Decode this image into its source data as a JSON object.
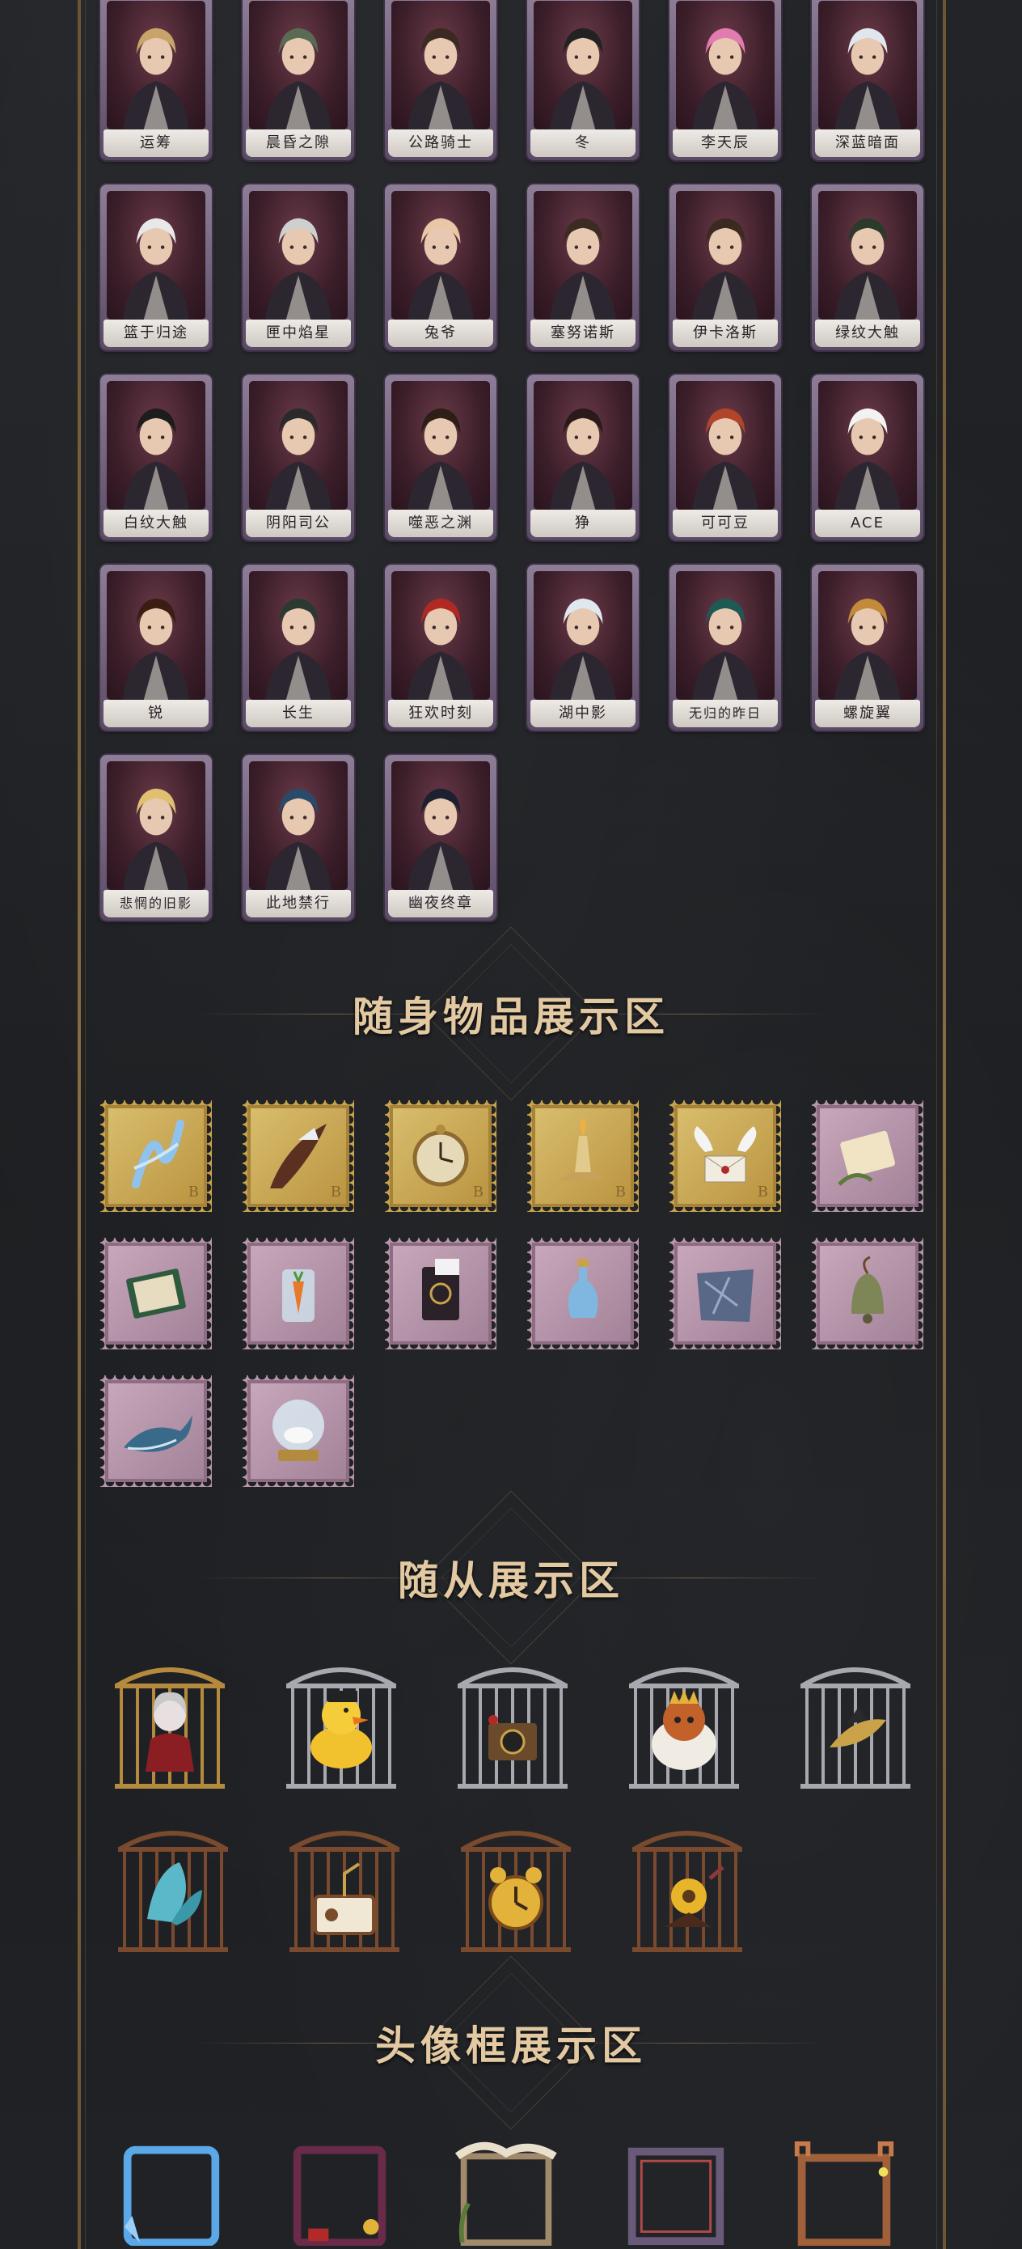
{
  "characters": [
    {
      "name": "运筹"
    },
    {
      "name": "晨昏之隙"
    },
    {
      "name": "公路骑士"
    },
    {
      "name": "冬"
    },
    {
      "name": "李天辰"
    },
    {
      "name": "深蓝暗面"
    },
    {
      "name": "篮于归途"
    },
    {
      "name": "匣中焰星"
    },
    {
      "name": "兔爷"
    },
    {
      "name": "塞努诺斯"
    },
    {
      "name": "伊卡洛斯"
    },
    {
      "name": "绿纹大触"
    },
    {
      "name": "白纹大触"
    },
    {
      "name": "阴阳司公"
    },
    {
      "name": "噬恶之渊"
    },
    {
      "name": "狰"
    },
    {
      "name": "可可豆"
    },
    {
      "name": "ACE"
    },
    {
      "name": "锐"
    },
    {
      "name": "长生"
    },
    {
      "name": "狂欢时刻"
    },
    {
      "name": "湖中影"
    },
    {
      "name": "无归的昨日"
    },
    {
      "name": "螺旋翼"
    },
    {
      "name": "悲惘的旧影"
    },
    {
      "name": "此地禁行"
    },
    {
      "name": "幽夜终章"
    }
  ],
  "sections": {
    "accessories_title": "随身物品展示区",
    "pets_title": "随从展示区",
    "avatar_frames_title": "头像框展示区"
  },
  "accessories": [
    {
      "style": "gold",
      "icon": "twisted-glass-icon",
      "tag": "B"
    },
    {
      "style": "gold",
      "icon": "feather-quill-icon",
      "tag": "B"
    },
    {
      "style": "gold",
      "icon": "pocket-watch-icon",
      "tag": "B"
    },
    {
      "style": "gold",
      "icon": "oil-lamp-icon",
      "tag": "B"
    },
    {
      "style": "gold",
      "icon": "winged-letter-icon",
      "tag": "B"
    },
    {
      "style": "pink",
      "icon": "scroll-icon",
      "tag": ""
    },
    {
      "style": "pink",
      "icon": "book-icon",
      "tag": ""
    },
    {
      "style": "pink",
      "icon": "carrot-jar-icon",
      "tag": ""
    },
    {
      "style": "pink",
      "icon": "card-box-icon",
      "tag": ""
    },
    {
      "style": "pink",
      "icon": "blue-bottle-icon",
      "tag": ""
    },
    {
      "style": "pink",
      "icon": "crystal-cloth-icon",
      "tag": ""
    },
    {
      "style": "pink",
      "icon": "bell-icon",
      "tag": ""
    },
    {
      "style": "pink",
      "icon": "whale-icon",
      "tag": ""
    },
    {
      "style": "pink",
      "icon": "snow-globe-icon",
      "tag": ""
    }
  ],
  "pets": [
    {
      "icon": "doll-pet-icon"
    },
    {
      "icon": "yellow-duck-pet-icon"
    },
    {
      "icon": "camera-pet-icon"
    },
    {
      "icon": "cat-king-pet-icon"
    },
    {
      "icon": "golden-quill-pet-icon"
    },
    {
      "icon": "leaf-pet-icon"
    },
    {
      "icon": "radio-pet-icon"
    },
    {
      "icon": "alarm-clock-pet-icon"
    },
    {
      "icon": "flower-gramophone-pet-icon"
    }
  ],
  "avatar_frames": [
    {
      "icon": "crystal-frame-icon"
    },
    {
      "icon": "carnival-frame-icon"
    },
    {
      "icon": "vine-frame-icon"
    },
    {
      "icon": "ornate-frame-icon"
    },
    {
      "icon": "castle-frame-icon"
    }
  ],
  "colors": {
    "background": "#1d1f22",
    "title_gold": "#e3c9a2",
    "card_purple": "#8d7d97",
    "stamp_gold": "#c9a44c",
    "stamp_pink": "#b796a8"
  }
}
